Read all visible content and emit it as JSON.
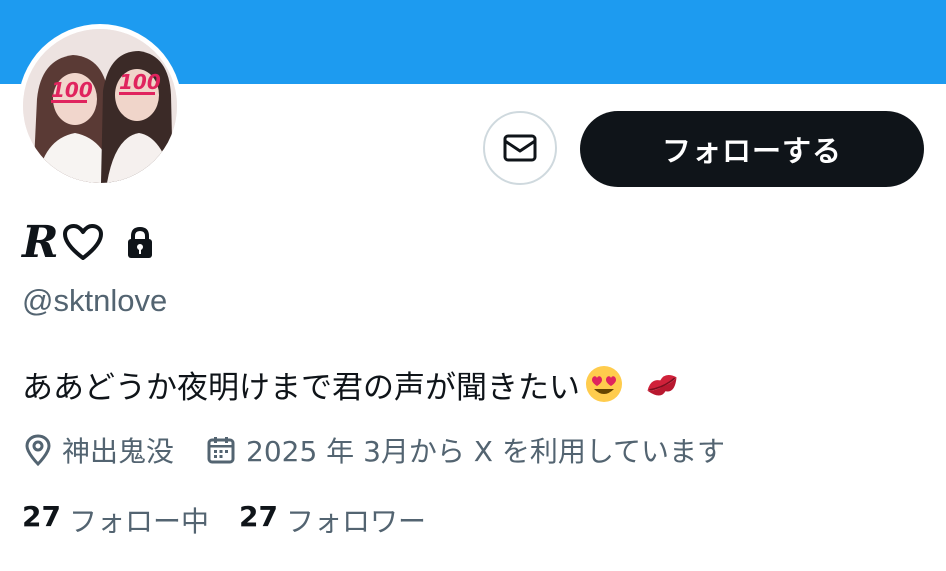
{
  "colors": {
    "banner": "#1d9bf0",
    "primary_text": "#0f1419",
    "secondary_text": "#536471",
    "button_border": "#cfd9de",
    "follow_bg": "#0f1419",
    "follow_text": "#ffffff"
  },
  "profile": {
    "display_name": "R",
    "handle": "@sktnlove",
    "bio": "ああどうか夜明けまで君の声が聞きたい",
    "location": "神出鬼没",
    "joined": "2025 年 3月から X を利用しています",
    "avatar_overlay_emoji": "100-emoji",
    "protected_icon": "lock-icon"
  },
  "actions": {
    "message_icon": "envelope-icon",
    "follow_label": "フォローする"
  },
  "stats": {
    "following_count": "27",
    "following_label": "フォロー中",
    "followers_count": "27",
    "followers_label": "フォロワー"
  }
}
